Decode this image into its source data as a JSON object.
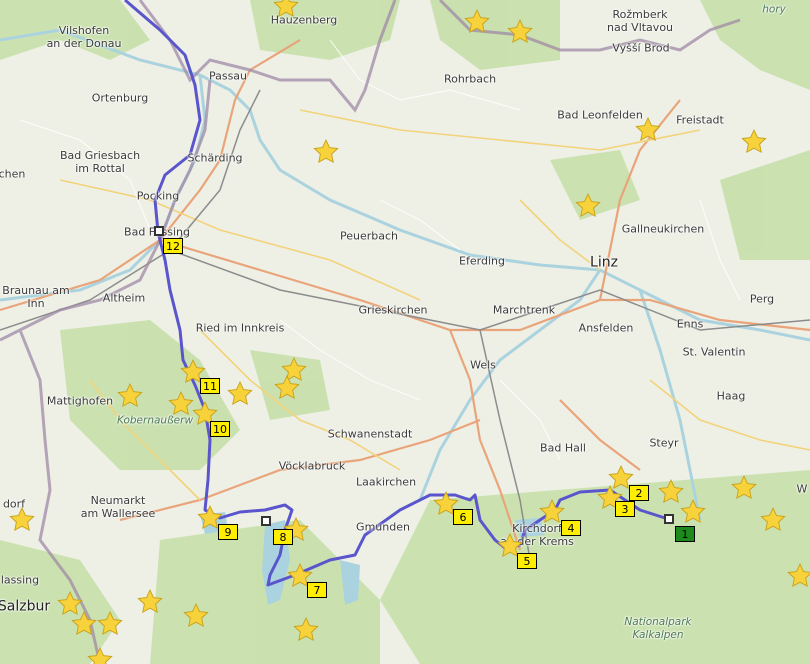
{
  "map": {
    "labels": {
      "vilshofen": "Vilshofen\nan der Donau",
      "hauzenberg": "Hauzenberg",
      "rozmberk": "Rožmberk\nnad Vltavou",
      "vyssi_brod": "Vyšší Brod",
      "hory": "hory",
      "passau": "Passau",
      "ortenburg": "Ortenburg",
      "rohrbach": "Rohrbach",
      "bad_leonfelden": "Bad Leonfelden",
      "freistadt": "Freistadt",
      "bad_griesbach": "Bad Griesbach\nim Rottal",
      "scharding": "Schärding",
      "chen": "chen",
      "pocking": "Pocking",
      "bad_fussing": "Bad Füssing",
      "peuerbach": "Peuerbach",
      "gallneukirchen": "Gallneukirchen",
      "eferding": "Eferding",
      "linz": "Linz",
      "braunau": "Braunau am\nInn",
      "altheim": "Altheim",
      "perg": "Perg",
      "grieskirchen": "Grieskirchen",
      "marchtrenk": "Marchtrenk",
      "ansfelden": "Ansfelden",
      "enns": "Enns",
      "ried": "Ried im Innkreis",
      "st_valentin": "St. Valentin",
      "wels": "Wels",
      "mattighofen": "Mattighofen",
      "kobernausser": "Kobernaußerw",
      "haag": "Haag",
      "schwanenstadt": "Schwanenstadt",
      "bad_hall": "Bad Hall",
      "steyr": "Steyr",
      "vocklabruck": "Vöcklabruck",
      "laakirchen": "Laakirchen",
      "neumarkt": "Neumarkt\nam Wallersee",
      "gmunden": "Gmunden",
      "kirchdorf": "Kirchdorf\nan der Krems",
      "dorf": "dorf",
      "w": "W",
      "lassing": "lassing",
      "salzburg": "Salzbur",
      "nationalpark": "Nationalpark\nKalkalpen"
    },
    "markers": [
      "1",
      "2",
      "3",
      "4",
      "5",
      "6",
      "7",
      "8",
      "9",
      "10",
      "11",
      "12"
    ],
    "colors": {
      "route": "#5a55cc",
      "marker": "#ffee00",
      "start_marker": "#1e8a1e",
      "star": "#f7d23a",
      "forest": "#c4dfa6",
      "water": "#aad3df",
      "border": "#a08aa6"
    },
    "icons": [
      "star-icon",
      "waypoint-square-icon"
    ]
  }
}
